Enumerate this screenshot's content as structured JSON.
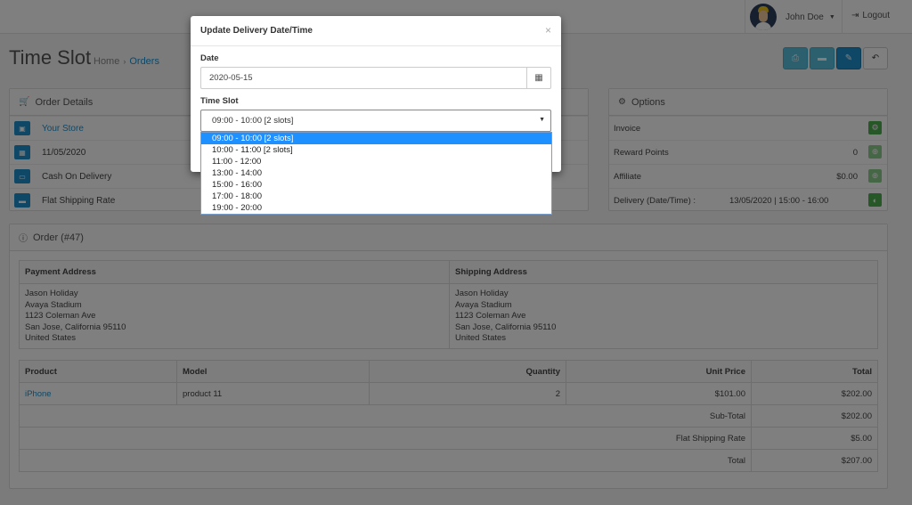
{
  "header": {
    "user_name": "John Doe",
    "logout_label": "Logout"
  },
  "page": {
    "title": "Time Slot",
    "breadcrumb": [
      "Home",
      "Orders"
    ]
  },
  "colors": {
    "primary": "#1e91cf",
    "info": "#5bc0de",
    "success": "#4cae4c",
    "dropdown_highlight": "#1e90ff"
  },
  "toolbar": {
    "icons": [
      "print-icon",
      "truck-icon",
      "pencil-icon",
      "reply-icon"
    ]
  },
  "order_details": {
    "heading": "Order Details",
    "rows": [
      {
        "icon": "cart-icon",
        "text": "Your Store"
      },
      {
        "icon": "calendar-icon",
        "text": "11/05/2020"
      },
      {
        "icon": "credit-card-icon",
        "text": "Cash On Delivery"
      },
      {
        "icon": "truck-icon",
        "text": "Flat Shipping Rate"
      }
    ]
  },
  "options": {
    "heading": "Options",
    "rows": [
      {
        "label": "Invoice",
        "value": "",
        "mid": ""
      },
      {
        "label": "Reward Points",
        "value": "0",
        "mid": ""
      },
      {
        "label": "Affiliate",
        "value": "$0.00",
        "mid": ""
      },
      {
        "label": "Delivery (Date/Time) :",
        "value": "",
        "mid": "13/05/2020 | 15:00 - 16:00"
      }
    ]
  },
  "order": {
    "heading": "Order (#47)",
    "payment_address_header": "Payment Address",
    "shipping_address_header": "Shipping Address",
    "payment_address": [
      "Jason Holiday",
      "Avaya Stadium",
      "1123 Coleman Ave",
      "San Jose, California 95110",
      "United States"
    ],
    "shipping_address": [
      "Jason Holiday",
      "Avaya Stadium",
      "1123 Coleman Ave",
      "San Jose, California 95110",
      "United States"
    ],
    "columns": [
      "Product",
      "Model",
      "Quantity",
      "Unit Price",
      "Total"
    ],
    "items": [
      {
        "product": "iPhone",
        "model": "product 11",
        "quantity": "2",
        "unit_price": "$101.00",
        "total": "$202.00"
      }
    ],
    "totals": [
      {
        "label": "Sub-Total",
        "value": "$202.00"
      },
      {
        "label": "Flat Shipping Rate",
        "value": "$5.00"
      },
      {
        "label": "Total",
        "value": "$207.00"
      }
    ]
  },
  "modal": {
    "title": "Update Delivery Date/Time",
    "close": "×",
    "date_label": "Date",
    "date_value": "2020-05-15",
    "timeslot_label": "Time Slot",
    "timeslot_selected": "09:00 - 10:00 [2 slots]",
    "timeslot_options": [
      "09:00 - 10:00 [2 slots]",
      "10:00 - 11:00 [2 slots]",
      "11:00 - 12:00",
      "13:00 - 14:00",
      "15:00 - 16:00",
      "17:00 - 18:00",
      "19:00 - 20:00"
    ]
  }
}
